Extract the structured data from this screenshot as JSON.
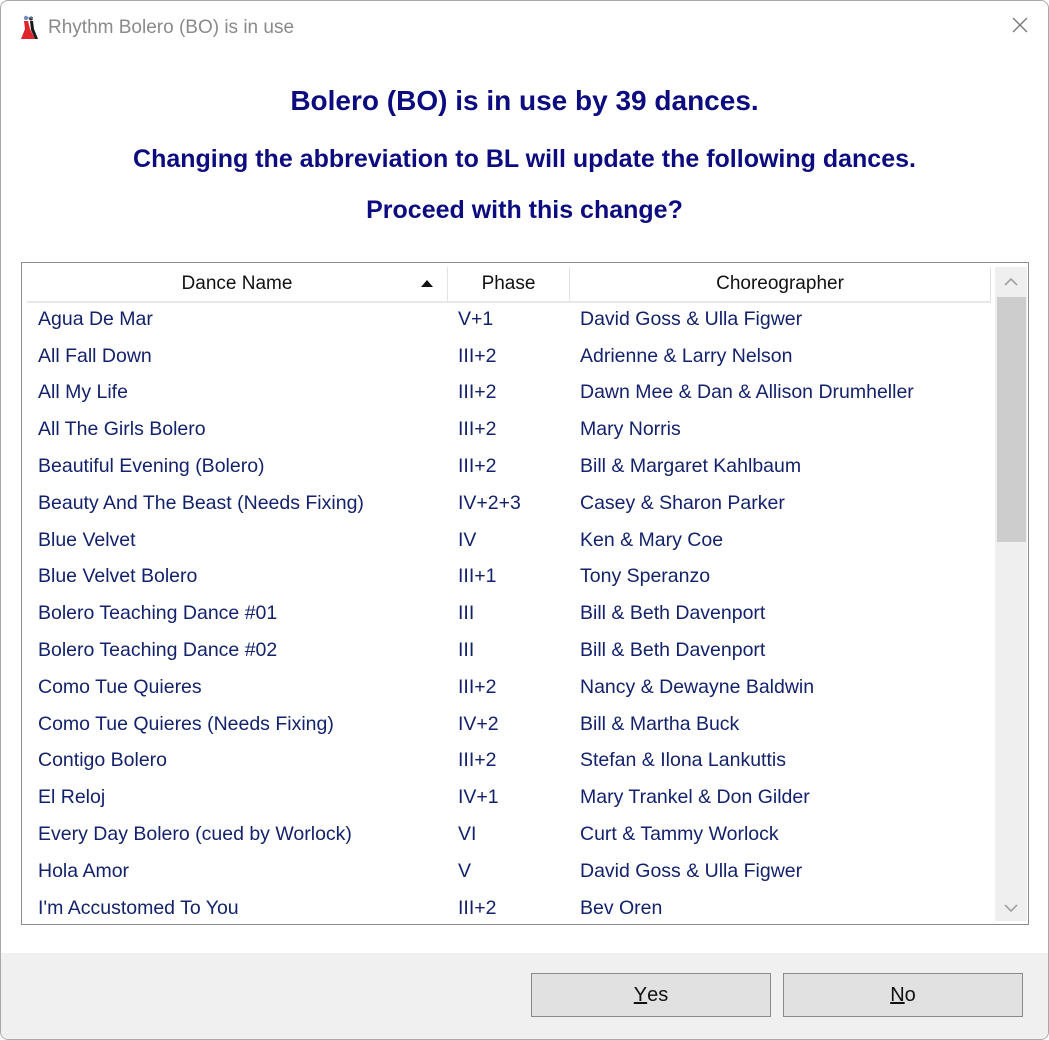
{
  "window": {
    "title": "Rhythm Bolero (BO) is in use",
    "app_icon": "dancing-couple-icon",
    "close_icon": "close-icon"
  },
  "message": {
    "line1": "Bolero (BO) is in use by 39 dances.",
    "line2": "Changing the abbreviation to BL will update the following dances.",
    "line3": "Proceed with this change?"
  },
  "table": {
    "columns": [
      {
        "label": "Dance Name",
        "sorted": "ascending"
      },
      {
        "label": "Phase"
      },
      {
        "label": "Choreographer"
      }
    ],
    "rows": [
      {
        "name": "Agua De Mar",
        "phase": "V+1",
        "choreographer": "David Goss & Ulla Figwer"
      },
      {
        "name": "All Fall Down",
        "phase": "III+2",
        "choreographer": "Adrienne & Larry Nelson"
      },
      {
        "name": "All My Life",
        "phase": "III+2",
        "choreographer": "Dawn Mee & Dan & Allison Drumheller"
      },
      {
        "name": "All The Girls Bolero",
        "phase": "III+2",
        "choreographer": "Mary Norris"
      },
      {
        "name": "Beautiful Evening (Bolero)",
        "phase": "III+2",
        "choreographer": "Bill & Margaret Kahlbaum"
      },
      {
        "name": "Beauty And The Beast (Needs Fixing)",
        "phase": "IV+2+3",
        "choreographer": "Casey & Sharon Parker"
      },
      {
        "name": "Blue Velvet",
        "phase": "IV",
        "choreographer": "Ken & Mary Coe"
      },
      {
        "name": "Blue Velvet Bolero",
        "phase": "III+1",
        "choreographer": "Tony Speranzo"
      },
      {
        "name": "Bolero Teaching Dance #01",
        "phase": "III",
        "choreographer": "Bill & Beth Davenport"
      },
      {
        "name": "Bolero Teaching Dance #02",
        "phase": "III",
        "choreographer": "Bill & Beth Davenport"
      },
      {
        "name": "Como Tue Quieres",
        "phase": "III+2",
        "choreographer": "Nancy & Dewayne Baldwin"
      },
      {
        "name": "Como Tue Quieres (Needs Fixing)",
        "phase": "IV+2",
        "choreographer": "Bill & Martha Buck"
      },
      {
        "name": "Contigo Bolero",
        "phase": "III+2",
        "choreographer": "Stefan & Ilona Lankuttis"
      },
      {
        "name": "El Reloj",
        "phase": "IV+1",
        "choreographer": "Mary Trankel & Don Gilder"
      },
      {
        "name": "Every Day Bolero (cued by Worlock)",
        "phase": "VI",
        "choreographer": "Curt & Tammy Worlock"
      },
      {
        "name": "Hola Amor",
        "phase": "V",
        "choreographer": "David Goss & Ulla Figwer"
      },
      {
        "name": "I'm Accustomed To You",
        "phase": "III+2",
        "choreographer": "Bev Oren"
      }
    ],
    "scroll_position_fraction": 0.0
  },
  "buttons": {
    "yes": {
      "mnemonic": "Y",
      "rest": "es"
    },
    "no": {
      "mnemonic": "N",
      "rest": "o"
    }
  }
}
